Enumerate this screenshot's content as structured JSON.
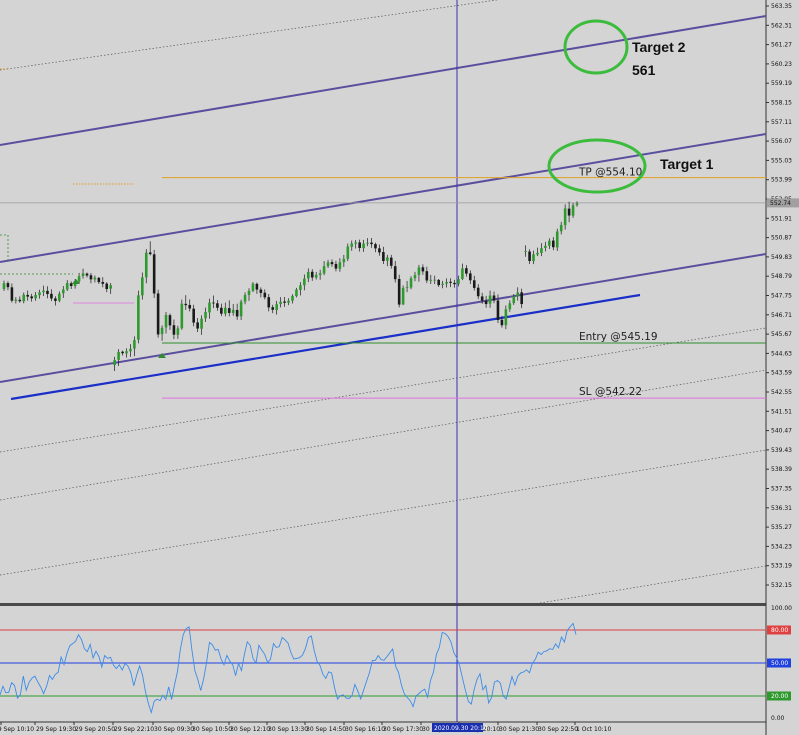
{
  "chart_data": [
    {
      "type": "candlestick",
      "y_ticks": [
        "563.35",
        "562.31",
        "561.27",
        "560.23",
        "559.19",
        "558.15",
        "557.11",
        "556.07",
        "555.03",
        "553.99",
        "552.95",
        "551.91",
        "550.87",
        "549.83",
        "548.79",
        "547.75",
        "546.71",
        "545.67",
        "544.63",
        "543.59",
        "542.55",
        "541.51",
        "540.47",
        "539.43",
        "538.39",
        "537.35",
        "536.31",
        "535.27",
        "534.23",
        "533.19",
        "532.15"
      ],
      "x_ticks": [
        "29 Sep 10:10",
        "29 Sep 19:30",
        "29 Sep 20:50",
        "29 Sep 22:10",
        "30 Sep 09:30",
        "30 Sep 10:50",
        "30 Sep 12:10",
        "30 Sep 13:30",
        "30 Sep 14:50",
        "30 Sep 16:10",
        "30 Sep 17:30",
        "30 Sep 18:50",
        "30 Sep 20:10",
        "30 Sep 21:30",
        "30 Sep 22:50",
        "1 Oct 10:10"
      ],
      "highlight_x_tick": "2020.09.30 20:10",
      "current_price": "552.74",
      "ylim": [
        531.6,
        563.6
      ],
      "levels": [
        {
          "name": "TP",
          "label": "TP @554.10",
          "value": 554.1,
          "color": "#e0a020"
        },
        {
          "name": "Entry",
          "label": "Entry @545.19",
          "value": 545.19,
          "color": "#2e8b2e"
        },
        {
          "name": "SL",
          "label": "SL @542.22",
          "value": 542.22,
          "color": "#e070e0"
        }
      ],
      "annotations": [
        {
          "text": "Target 1"
        },
        {
          "text": "Target 2"
        },
        {
          "text": "561"
        }
      ],
      "ohlc": [
        [
          548.1,
          548.55,
          548.0,
          548.41
        ],
        [
          548.42,
          548.52,
          548.03,
          548.2
        ],
        [
          548.19,
          548.4,
          547.37,
          547.47
        ],
        [
          547.46,
          547.66,
          547.32,
          547.53
        ],
        [
          547.52,
          547.7,
          547.36,
          547.44
        ],
        [
          547.44,
          547.91,
          547.33,
          547.79
        ],
        [
          547.78,
          548.02,
          547.47,
          547.69
        ],
        [
          547.7,
          547.84,
          547.42,
          547.6
        ],
        [
          547.6,
          547.94,
          547.47,
          547.78
        ],
        [
          547.77,
          548.06,
          547.58,
          547.92
        ],
        [
          547.93,
          548.28,
          547.72,
          548.01
        ],
        [
          548.0,
          548.25,
          547.6,
          547.83
        ],
        [
          547.84,
          548.09,
          547.45,
          547.59
        ],
        [
          547.59,
          547.71,
          547.21,
          547.46
        ],
        [
          547.47,
          547.97,
          547.39,
          547.85
        ],
        [
          547.87,
          548.26,
          547.62,
          548.07
        ],
        [
          548.07,
          548.58,
          547.99,
          548.42
        ],
        [
          548.41,
          548.51,
          548.1,
          548.26
        ],
        [
          548.26,
          548.64,
          548.12,
          548.52
        ],
        [
          548.51,
          548.97,
          548.39,
          548.79
        ],
        [
          548.8,
          549.2,
          548.66,
          548.94
        ],
        [
          548.93,
          548.99,
          548.73,
          548.83
        ],
        [
          548.84,
          548.96,
          548.41,
          548.62
        ],
        [
          548.62,
          548.83,
          548.45,
          548.71
        ],
        [
          548.7,
          548.75,
          548.38,
          548.47
        ],
        [
          548.48,
          548.74,
          548.19,
          548.38
        ],
        [
          548.39,
          548.47,
          547.93,
          548.1
        ],
        [
          548.12,
          548.42,
          547.83,
          548.3
        ],
        [
          544.0,
          544.44,
          543.68,
          544.27
        ],
        [
          544.28,
          544.86,
          543.95,
          544.71
        ],
        [
          544.72,
          544.78,
          544.52,
          544.64
        ],
        [
          544.63,
          544.91,
          544.4,
          544.75
        ],
        [
          544.74,
          545.13,
          544.44,
          544.88
        ],
        [
          544.89,
          545.55,
          544.48,
          545.35
        ],
        [
          545.37,
          548.01,
          545.17,
          547.76
        ],
        [
          547.76,
          548.99,
          547.53,
          548.73
        ],
        [
          548.73,
          550.25,
          548.41,
          550.06
        ],
        [
          550.07,
          550.67,
          549.91,
          549.98
        ],
        [
          549.97,
          550.21,
          547.62,
          547.86
        ],
        [
          547.86,
          548.06,
          545.48,
          545.65
        ],
        [
          545.67,
          546.14,
          545.31,
          546.01
        ],
        [
          546.03,
          546.86,
          545.7,
          546.7
        ],
        [
          546.69,
          546.78,
          545.9,
          546.14
        ],
        [
          546.15,
          546.46,
          545.4,
          545.64
        ],
        [
          545.63,
          546.12,
          545.41,
          545.98
        ],
        [
          545.98,
          547.53,
          545.9,
          547.31
        ],
        [
          547.3,
          547.77,
          546.97,
          547.23
        ],
        [
          547.24,
          547.54,
          546.89,
          547.05
        ],
        [
          547.04,
          547.25,
          546.09,
          546.29
        ],
        [
          546.3,
          546.54,
          545.78,
          545.97
        ],
        [
          545.96,
          546.68,
          545.63,
          546.5
        ],
        [
          546.52,
          547.1,
          546.32,
          546.86
        ],
        [
          546.84,
          547.58,
          546.5,
          547.37
        ],
        [
          547.37,
          547.75,
          547.07,
          547.33
        ],
        [
          547.33,
          547.51,
          546.93,
          547.09
        ],
        [
          547.09,
          547.31,
          546.64,
          546.77
        ],
        [
          546.77,
          547.37,
          546.63,
          547.09
        ],
        [
          547.07,
          547.49,
          546.63,
          546.81
        ],
        [
          546.81,
          547.29,
          546.66,
          546.98
        ],
        [
          546.97,
          547.31,
          546.44,
          546.62
        ],
        [
          546.63,
          547.53,
          546.43,
          547.42
        ],
        [
          547.42,
          547.92,
          547.28,
          547.78
        ],
        [
          547.78,
          548.14,
          547.46,
          548.0
        ],
        [
          548.0,
          548.47,
          547.93,
          548.39
        ],
        [
          548.38,
          548.45,
          547.84,
          548.07
        ],
        [
          548.07,
          548.19,
          547.65,
          547.89
        ],
        [
          547.9,
          548.08,
          547.54,
          547.65
        ],
        [
          547.66,
          547.83,
          546.9,
          547.11
        ],
        [
          547.12,
          547.25,
          546.8,
          546.98
        ],
        [
          546.97,
          547.46,
          546.72,
          547.28
        ],
        [
          547.29,
          547.66,
          547.11,
          547.41
        ],
        [
          547.43,
          547.67,
          547.14,
          547.36
        ],
        [
          547.36,
          547.6,
          547.23,
          547.47
        ],
        [
          547.47,
          547.82,
          547.32,
          547.73
        ],
        [
          547.72,
          548.16,
          547.65,
          548.07
        ],
        [
          548.05,
          548.47,
          547.76,
          548.3
        ],
        [
          548.3,
          548.88,
          548.03,
          548.66
        ],
        [
          548.67,
          549.21,
          548.47,
          549.02
        ],
        [
          549.03,
          549.17,
          548.54,
          548.72
        ],
        [
          548.72,
          549.02,
          548.61,
          548.86
        ],
        [
          548.86,
          549.14,
          548.6,
          548.95
        ],
        [
          548.94,
          549.6,
          548.85,
          549.33
        ],
        [
          549.33,
          549.67,
          549.23,
          549.54
        ],
        [
          549.55,
          549.7,
          549.3,
          549.44
        ],
        [
          549.45,
          549.62,
          549.05,
          549.2
        ],
        [
          549.19,
          549.76,
          549.03,
          549.54
        ],
        [
          549.54,
          549.94,
          549.29,
          549.72
        ],
        [
          549.72,
          550.55,
          549.6,
          550.39
        ],
        [
          550.37,
          550.71,
          550.16,
          550.55
        ],
        [
          550.54,
          550.74,
          550.28,
          550.61
        ],
        [
          550.61,
          550.76,
          550.12,
          550.31
        ],
        [
          550.3,
          550.75,
          550.1,
          550.55
        ],
        [
          550.54,
          550.84,
          550.41,
          550.59
        ],
        [
          550.6,
          550.85,
          550.32,
          550.52
        ],
        [
          550.52,
          550.6,
          550.08,
          550.29
        ],
        [
          550.29,
          550.5,
          549.89,
          550.07
        ],
        [
          550.09,
          550.38,
          549.45,
          549.61
        ],
        [
          549.62,
          549.94,
          549.33,
          549.8
        ],
        [
          549.79,
          549.94,
          549.2,
          549.35
        ],
        [
          549.33,
          549.61,
          548.45,
          548.63
        ],
        [
          548.64,
          548.87,
          547.11,
          547.26
        ],
        [
          547.27,
          548.29,
          547.23,
          548.16
        ],
        [
          548.16,
          548.53,
          547.93,
          548.2
        ],
        [
          548.18,
          548.79,
          548.09,
          548.68
        ],
        [
          548.68,
          549.02,
          548.52,
          548.85
        ],
        [
          548.86,
          549.4,
          548.5,
          549.26
        ],
        [
          549.27,
          549.43,
          548.87,
          549.05
        ],
        [
          549.06,
          549.3,
          548.42,
          548.56
        ],
        [
          548.55,
          548.86,
          548.37,
          548.59
        ],
        [
          548.58,
          548.82,
          548.37,
          548.6
        ],
        [
          548.59,
          548.64,
          548.21,
          548.31
        ],
        [
          548.32,
          548.54,
          548.14,
          548.38
        ],
        [
          548.39,
          548.67,
          548.18,
          548.48
        ],
        [
          548.49,
          548.68,
          548.2,
          548.43
        ],
        [
          548.43,
          548.59,
          548.17,
          548.36
        ],
        [
          548.37,
          548.82,
          548.24,
          548.63
        ],
        [
          548.64,
          549.47,
          548.58,
          549.21
        ],
        [
          549.22,
          549.39,
          548.77,
          548.93
        ],
        [
          548.94,
          549.1,
          548.37,
          548.57
        ],
        [
          548.57,
          548.81,
          548.02,
          548.16
        ],
        [
          548.17,
          548.36,
          547.55,
          547.71
        ],
        [
          547.7,
          547.9,
          547.3,
          547.48
        ],
        [
          547.46,
          547.73,
          547.09,
          547.29
        ],
        [
          547.31,
          548.01,
          547.09,
          547.75
        ],
        [
          547.75,
          547.96,
          547.33,
          547.48
        ],
        [
          547.48,
          547.81,
          546.27,
          546.43
        ],
        [
          546.44,
          546.65,
          546.02,
          546.15
        ],
        [
          546.15,
          547.21,
          545.93,
          547.01
        ],
        [
          547.01,
          547.49,
          546.87,
          547.33
        ],
        [
          547.34,
          547.83,
          547.24,
          547.71
        ],
        [
          547.7,
          548.19,
          547.47,
          547.91
        ],
        [
          547.92,
          548.12,
          547.07,
          547.29
        ],
        [
          550.13,
          550.46,
          549.84,
          550.14
        ],
        [
          550.12,
          550.24,
          549.45,
          549.61
        ],
        [
          549.6,
          550.17,
          549.44,
          549.97
        ],
        [
          549.96,
          550.33,
          549.87,
          550.05
        ],
        [
          550.04,
          550.57,
          549.87,
          550.3
        ],
        [
          550.31,
          550.64,
          550.13,
          550.43
        ],
        [
          550.43,
          550.83,
          550.26,
          550.7
        ],
        [
          550.71,
          550.9,
          550.19,
          550.35
        ],
        [
          550.34,
          551.35,
          550.15,
          551.2
        ],
        [
          551.21,
          551.72,
          551.04,
          551.55
        ],
        [
          551.54,
          552.66,
          551.3,
          552.44
        ],
        [
          552.43,
          552.8,
          551.7,
          552.06
        ],
        [
          552.05,
          552.74,
          551.93,
          552.61
        ],
        [
          552.62,
          552.82,
          552.53,
          552.71
        ]
      ],
      "rsi": {
        "levels": [
          "100.00",
          "80.00",
          "50.00",
          "20.00",
          "0.00"
        ],
        "values": [
          20.9,
          28.9,
          23.0,
          23.3,
          32.1,
          29.6,
          18.2,
          21.3,
          38.2,
          25.3,
          32.5,
          36.3,
          38.0,
          32.7,
          28.2,
          22.2,
          28.5,
          38.6,
          35.1,
          39.6,
          41.6,
          55.5,
          48.6,
          58.5,
          65.7,
          67.6,
          69.7,
          75.7,
          71.3,
          62.9,
          60.4,
          66.9,
          54.6,
          60.6,
          56.0,
          46.4,
          56.8,
          54.2,
          55.2,
          48.0,
          45.0,
          48.4,
          43.5,
          49.5,
          47.2,
          41.0,
          29.3,
          39.1,
          47.4,
          39.1,
          23.7,
          13.2,
          5.0,
          15.3,
          17.2,
          15.8,
          20.6,
          16.9,
          28.3,
          16.8,
          30.0,
          42.4,
          62.6,
          76.1,
          81.2,
          82.8,
          61.2,
          43.1,
          35.1,
          25.0,
          35.4,
          50.3,
          68.7,
          66.5,
          61.6,
          62.4,
          53.5,
          48.4,
          57.0,
          51.6,
          48.4,
          38.5,
          49.7,
          43.2,
          57.9,
          69.2,
          66.0,
          54.0,
          49.9,
          66.1,
          61.7,
          57.9,
          50.5,
          53.4,
          67.6,
          64.1,
          65.0,
          73.3,
          70.9,
          68.1,
          59.5,
          53.6,
          54.1,
          54.9,
          57.1,
          63.4,
          73.1,
          74.5,
          61.4,
          51.5,
          47.7,
          39.8,
          36.1,
          42.0,
          40.9,
          27.7,
          17.1,
          20.4,
          21.0,
          18.1,
          17.7,
          20.5,
          30.5,
          24.4,
          17.4,
          25.3,
          33.3,
          41.4,
          52.4,
          52.4,
          56.7,
          53.1,
          52.5,
          55.7,
          59.3,
          62.7,
          47.1,
          41.5,
          29.6,
          21.8,
          18.6,
          15.7,
          10.4,
          20.0,
          22.2,
          24.6,
          26.2,
          18.9,
          34.2,
          41.8,
          57.8,
          64.1,
          77.7,
          76.8,
          74.2,
          69.3,
          59.5,
          54.7,
          47.7,
          36.2,
          24.8,
          15.0,
          12.6,
          26.2,
          35.3,
          40.3,
          25.7,
          29.5,
          13.6,
          18.6,
          32.7,
          34.1,
          31.6,
          19.8,
          17.3,
          27.6,
          37.6,
          30.0,
          38.1,
          41.0,
          41.8,
          43.8,
          41.1,
          49.9,
          53.3,
          59.9,
          57.7,
          60.4,
          61.1,
          63.0,
          62.3,
          67.4,
          63.7,
          73.6,
          69.1,
          79.8,
          83.0,
          86.0,
          75.8
        ]
      }
    }
  ]
}
